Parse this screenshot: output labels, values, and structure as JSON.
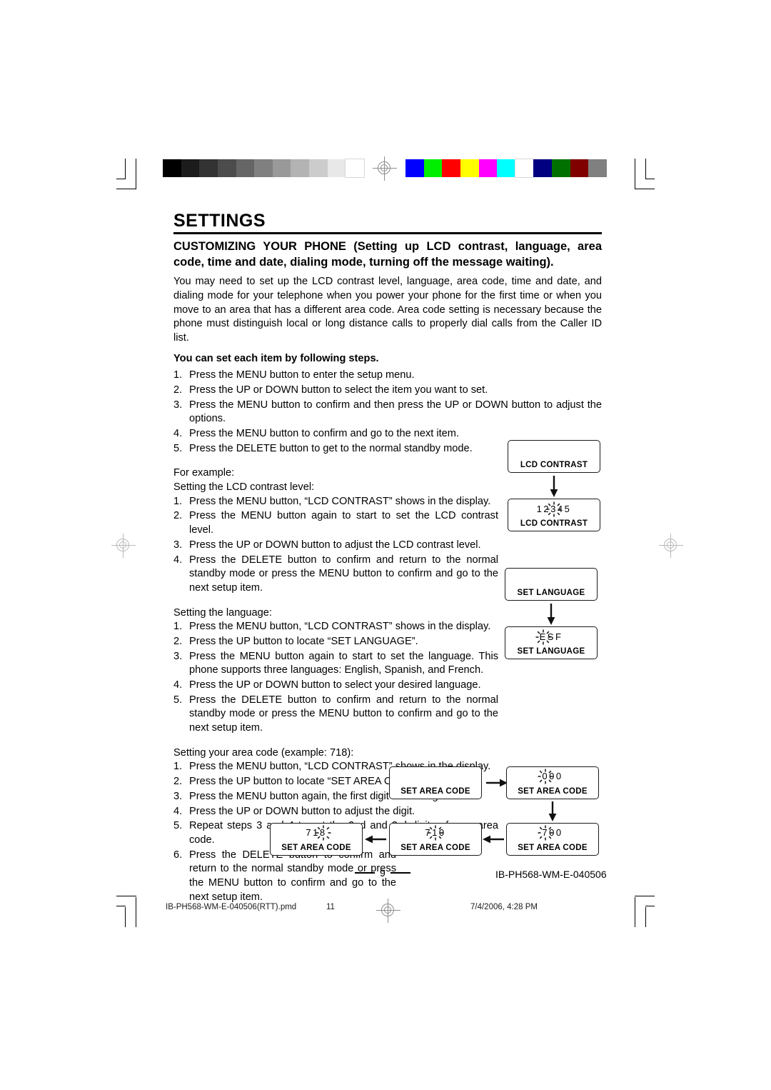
{
  "document": {
    "section_title": "SETTINGS",
    "sub_title_line1": "CUSTOMIZING YOUR PHONE (Setting up LCD contrast, language, area",
    "sub_title_line2": "code, time and date, dialing mode, turning off the message waiting).",
    "intro_paragraph": "You may need to set up the LCD contrast level, language, area code, time and date, and dialing mode for your telephone when you power your phone for the first time or when you move to an area that has a different area code. Area code setting is necessary because the phone must distinguish local or long distance calls to properly dial calls from the Caller ID list.",
    "steps_heading": "You can set each item by following steps.",
    "general_steps": [
      {
        "num": "1.",
        "text": "Press the MENU button to enter the setup menu."
      },
      {
        "num": "2.",
        "text": "Press the UP or DOWN button to select the item you want to set."
      },
      {
        "num": "3.",
        "text": "Press the MENU button to confirm and then press the UP or DOWN button to adjust the options."
      },
      {
        "num": "4.",
        "text": "Press the MENU button to confirm and go to the next item."
      },
      {
        "num": "5.",
        "text": "Press the DELETE button to get to the normal standby mode."
      }
    ],
    "for_example": "For example:",
    "contrast": {
      "heading": "Setting the LCD contrast level:",
      "steps": [
        {
          "num": "1.",
          "text": "Press the MENU button, “LCD CONTRAST” shows in the display."
        },
        {
          "num": "2.",
          "text": "Press the MENU button again to start to set the LCD contrast level."
        },
        {
          "num": "3.",
          "text": "Press the UP or DOWN button to adjust the LCD contrast level."
        },
        {
          "num": "4.",
          "text": "Press the DELETE button to confirm and return to the normal standby mode or press the MENU button to confirm and go to the next setup item."
        }
      ]
    },
    "language": {
      "heading": "Setting the language:",
      "steps": [
        {
          "num": "1.",
          "text": "Press the MENU button, “LCD CONTRAST” shows in the display."
        },
        {
          "num": "2.",
          "text": "Press the UP button to locate “SET LANGUAGE”."
        },
        {
          "num": "3.",
          "text": "Press the MENU button again to start to set the language. This phone supports three languages: English, Spanish, and French."
        },
        {
          "num": "4.",
          "text": "Press the UP or DOWN button to select your desired language."
        },
        {
          "num": "5.",
          "text": "Press the DELETE button to confirm and return to the normal standby mode or press the MENU button to confirm and go to the next setup item."
        }
      ]
    },
    "area_code": {
      "heading": "Setting your area code (example: 718):",
      "steps": [
        {
          "num": "1.",
          "text": "Press the MENU button, “LCD CONTRAST” shows in the display."
        },
        {
          "num": "2.",
          "text": "Press the UP button to locate “SET AREA CODE”."
        },
        {
          "num": "3.",
          "text": "Press the MENU button again, the first digit is flashing."
        },
        {
          "num": "4.",
          "text": "Press the UP or DOWN button to adjust the digit."
        },
        {
          "num": "5.",
          "text": "Repeat steps 3 and 4 to set the 2nd and 3rd digits of your area code."
        },
        {
          "num": "6.",
          "text": "Press the DELETE button to confirm and return to the normal standby mode or press the MENU button to confirm and go to the next setup item."
        }
      ]
    }
  },
  "lcd_diagrams": {
    "contrast_1": {
      "label": "LCD CONTRAST",
      "digits": ""
    },
    "contrast_2": {
      "label": "LCD CONTRAST",
      "chars": [
        "1",
        "2",
        "3",
        "4",
        "5"
      ],
      "flash_index": 2
    },
    "language_1": {
      "label": "SET LANGUAGE",
      "digits": ""
    },
    "language_2": {
      "label": "SET LANGUAGE",
      "chars": [
        "E",
        "S",
        "F"
      ],
      "flash_index": 0
    },
    "area_1": {
      "label": "SET AREA CODE",
      "digits": ""
    },
    "area_2": {
      "label": "SET AREA CODE",
      "chars": [
        "0",
        "0",
        "0"
      ],
      "flash_index": 0
    },
    "area_3": {
      "label": "SET AREA CODE",
      "chars": [
        "7",
        "0",
        "0"
      ],
      "flash_index": 0
    },
    "area_4": {
      "label": "SET AREA CODE",
      "chars": [
        "7",
        "1",
        "0"
      ],
      "flash_index": 1
    },
    "area_5": {
      "label": "SET AREA CODE",
      "chars": [
        "7",
        "1",
        "8"
      ],
      "flash_index": 2
    }
  },
  "footer": {
    "page_number": "9",
    "doc_code": "IB-PH568-WM-E-040506",
    "print_filename": "IB-PH568-WM-E-040506(RTT).pmd",
    "print_page": "11",
    "print_timestamp": "7/4/2006, 4:28 PM"
  },
  "calibration": {
    "grayscale": [
      "#000000",
      "#1c1c1c",
      "#333333",
      "#4c4c4c",
      "#666666",
      "#808080",
      "#999999",
      "#b3b3b3",
      "#cccccc",
      "#e8e8e8",
      "#ffffff"
    ],
    "colors": [
      "#0000ff",
      "#00ee00",
      "#fe0000",
      "#ffff00",
      "#ff00ff",
      "#00ffff",
      "#ffffff",
      "#000080",
      "#007000",
      "#800000",
      "#808080"
    ]
  }
}
